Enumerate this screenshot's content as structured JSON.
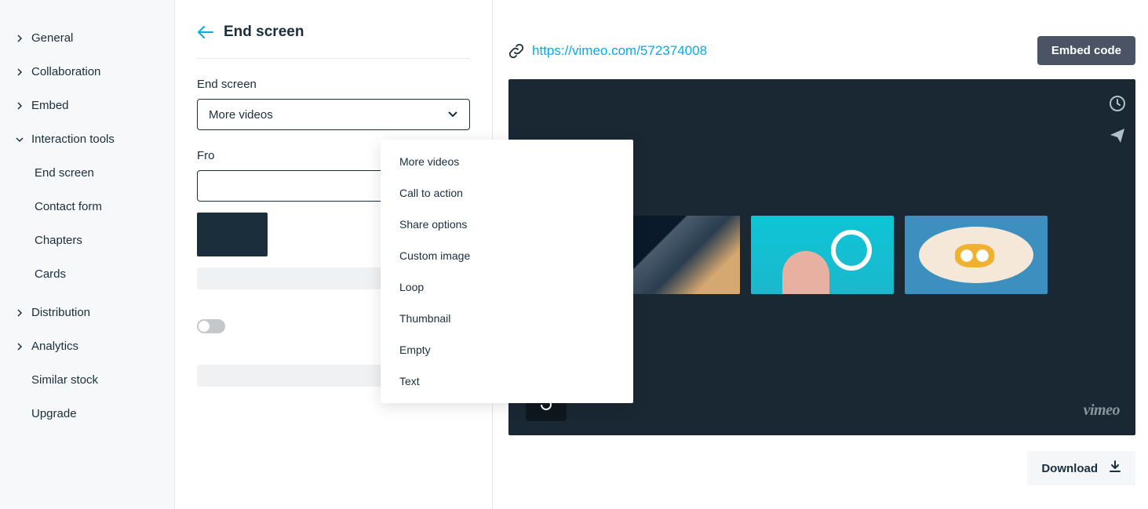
{
  "sidebar": {
    "items": [
      {
        "label": "General",
        "chevron": "right"
      },
      {
        "label": "Collaboration",
        "chevron": "right"
      },
      {
        "label": "Embed",
        "chevron": "right"
      },
      {
        "label": "Interaction tools",
        "chevron": "down"
      },
      {
        "label": "Distribution",
        "chevron": "right"
      },
      {
        "label": "Analytics",
        "chevron": "right"
      }
    ],
    "interaction_children": [
      {
        "label": "End screen"
      },
      {
        "label": "Contact form"
      },
      {
        "label": "Chapters"
      },
      {
        "label": "Cards"
      }
    ],
    "plain_items": [
      {
        "label": "Similar stock"
      },
      {
        "label": "Upgrade"
      }
    ]
  },
  "panel": {
    "title": "End screen",
    "field_label": "End screen",
    "select_value": "More videos",
    "from_label_partial": "Fro"
  },
  "dropdown": {
    "options": [
      "More videos",
      "Call to action",
      "Share options",
      "Custom image",
      "Loop",
      "Thumbnail",
      "Empty",
      "Text"
    ]
  },
  "preview": {
    "url": "https://vimeo.com/572374008",
    "embed_label": "Embed code",
    "download_label": "Download",
    "logo": "vimeo"
  }
}
